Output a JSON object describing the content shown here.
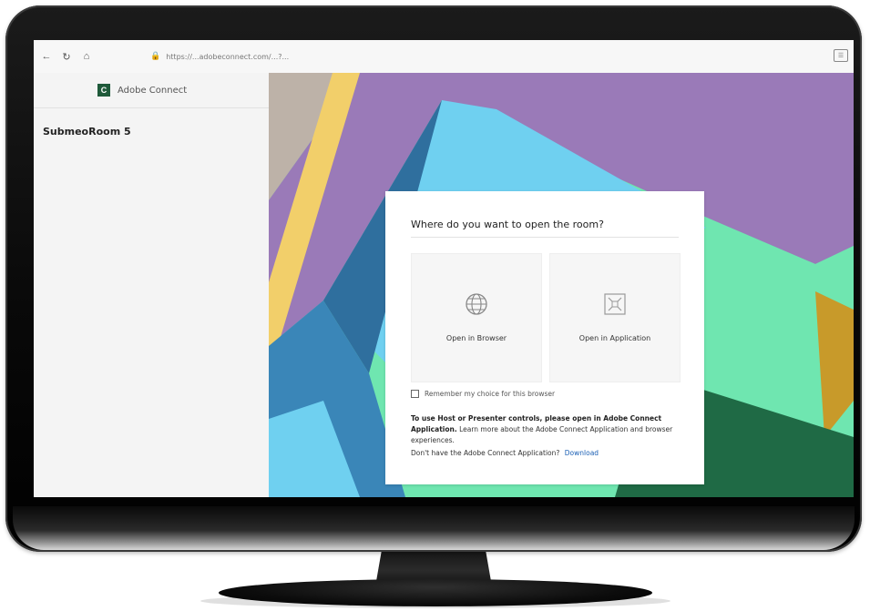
{
  "browser": {
    "url": "https://...adobeconnect.com/...?...",
    "back_icon": "arrow-left-icon",
    "refresh_icon": "refresh-icon",
    "home_icon": "home-icon",
    "lock_icon": "lock-icon",
    "reader_icon": "reader-view-icon"
  },
  "sidebar": {
    "brand_name": "Adobe Connect",
    "room_name": "SubmeoRoom 5"
  },
  "dialog": {
    "title": "Where do you want to open the room?",
    "options": [
      {
        "label": "Open in Browser",
        "icon": "globe-icon"
      },
      {
        "label": "Open in Application",
        "icon": "application-icon"
      }
    ],
    "remember_label": "Remember my choice for this browser",
    "info_bold": "To use Host or Presenter controls, please open in Adobe Connect Application.",
    "info_text": "Learn more about the Adobe Connect Application and browser experiences.",
    "download_prompt": "Don't have the Adobe Connect Application?",
    "download_link": "Download"
  },
  "colors": {
    "accent_green": "#1f5a3a",
    "link_blue": "#1a5fb4",
    "art_purple": "#9a7ab8",
    "art_blue": "#3a86b8",
    "art_mint": "#6fe6b0",
    "art_cyan": "#6fd0f0",
    "art_yellow": "#f2cf6a",
    "art_gold": "#c89a2a"
  }
}
